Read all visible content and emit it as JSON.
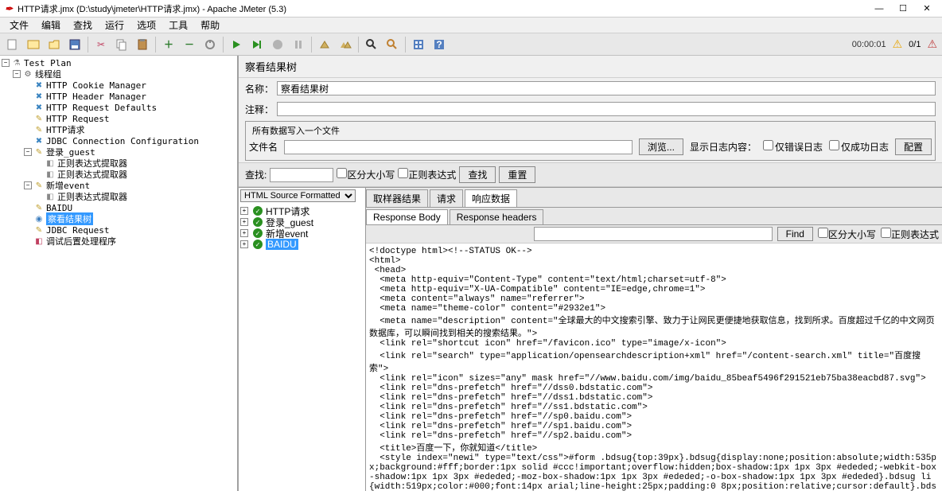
{
  "window": {
    "title": "HTTP请求.jmx (D:\\study\\jmeter\\HTTP请求.jmx) - Apache JMeter (5.3)"
  },
  "menu": {
    "file": "文件",
    "edit": "编辑",
    "search": "查找",
    "run": "运行",
    "options": "选项",
    "tools": "工具",
    "help": "帮助"
  },
  "status": {
    "timer": "00:00:01",
    "counter": "0/1"
  },
  "tree": {
    "root": "Test Plan",
    "threadgroup": "线程组",
    "items": [
      "HTTP Cookie Manager",
      "HTTP Header Manager",
      "HTTP Request Defaults",
      "HTTP Request",
      "HTTP请求",
      "JDBC Connection Configuration"
    ],
    "login": "登录_guest",
    "login_children": [
      "正则表达式提取器",
      "正则表达式提取器"
    ],
    "newevent": "新增event",
    "newevent_children": [
      "正则表达式提取器"
    ],
    "baidu": "BAIDU",
    "viewresults": "察看结果树",
    "jdbcreq": "JDBC Request",
    "debug": "调试后置处理程序"
  },
  "panel": {
    "title": "察看结果树",
    "name_label": "名称：",
    "name_value": "察看结果树",
    "comment_label": "注释：",
    "comment_value": "",
    "file_fieldset": "所有数据写入一个文件",
    "filename_label": "文件名",
    "filename_value": "",
    "browse": "浏览...",
    "logcontent_label": "显示日志内容：",
    "cb_erroronly": "仅错误日志",
    "cb_successonly": "仅成功日志",
    "configure": "配置",
    "search_label": "查找:",
    "cb_casesens": "区分大小写",
    "cb_regex": "正则表达式",
    "btn_search": "查找",
    "btn_reset": "重置"
  },
  "results": {
    "format_select": "HTML Source Formatted",
    "items": [
      "HTTP请求",
      "登录_guest",
      "新增event",
      "BAIDU"
    ],
    "selected": "BAIDU",
    "tabs": [
      "取样器结果",
      "请求",
      "响应数据"
    ],
    "subtabs": [
      "Response Body",
      "Response headers"
    ],
    "find_btn": "Find",
    "find_cb1": "区分大小写",
    "find_cb2": "正则表达式"
  },
  "response_body": "<!doctype html><!--STATUS OK-->\n<html>\n <head>\n  <meta http-equiv=\"Content-Type\" content=\"text/html;charset=utf-8\">\n  <meta http-equiv=\"X-UA-Compatible\" content=\"IE=edge,chrome=1\">\n  <meta content=\"always\" name=\"referrer\">\n  <meta name=\"theme-color\" content=\"#2932e1\">\n  <meta name=\"description\" content=\"全球最大的中文搜索引擎、致力于让网民更便捷地获取信息，找到所求。百度超过千亿的中文网页数据库，可以瞬间找到相关的搜索结果。\">\n  <link rel=\"shortcut icon\" href=\"/favicon.ico\" type=\"image/x-icon\">\n  <link rel=\"search\" type=\"application/opensearchdescription+xml\" href=\"/content-search.xml\" title=\"百度搜索\">\n  <link rel=\"icon\" sizes=\"any\" mask href=\"//www.baidu.com/img/baidu_85beaf5496f291521eb75ba38eacbd87.svg\">\n  <link rel=\"dns-prefetch\" href=\"//dss0.bdstatic.com\">\n  <link rel=\"dns-prefetch\" href=\"//dss1.bdstatic.com\">\n  <link rel=\"dns-prefetch\" href=\"//ss1.bdstatic.com\">\n  <link rel=\"dns-prefetch\" href=\"//sp0.baidu.com\">\n  <link rel=\"dns-prefetch\" href=\"//sp1.baidu.com\">\n  <link rel=\"dns-prefetch\" href=\"//sp2.baidu.com\">\n  <title>百度一下，你就知道</title>\n  <style index=\"newi\" type=\"text/css\">#form .bdsug{top:39px}.bdsug{display:none;position:absolute;width:535px;background:#fff;border:1px solid #ccc!important;overflow:hidden;box-shadow:1px 1px 3px #ededed;-webkit-box-shadow:1px 1px 3px #ededed;-moz-box-shadow:1px 1px 3px #ededed;-o-box-shadow:1px 1px 3px #ededed}.bdsug li{width:519px;color:#000;font:14px arial;line-height:25px;padding:0 8px;position:relative;cursor:default}.bdsug li.bdsug-s{background:#f0f0f0}.bdsug-store span,.bdsug-store b{color:#7A77C8}.bdsug-store-del{font-size:12px;color:#666;text-decoration:underline;position:absolute;right:8px;top:0;cursor:pointer;display:none}.bdsug-s .bdsug-store-del{display:inline-block}.bdsug-ala{display:inline-block;border-bottom:1px solid #e6e6e6}.bdsug-ala h3{line-height:14px;background:url(//www.baidu.com/img/sug_bd.png?v=09816787.png) no-repeat left center;margin:6px 0 4px;font-size:12px;font-weight:400;color:#7B7B7B;padding-left:20px}.bdsug-ala p{font-size:14px;font-weight:700;padding-left:20px}#m .bdsug .bdsug-direct p{color:#00e;font-weight:700;line-height:34px;padding:0 8px;margin-top:0;cursor:pointer;white-space:nowrap;overflow:hidden}#m .bdsug .bdsug-direct p img{width:16px;height:16px;margin:7px 6px 9px 0;vertical-align:middle}#m .bdsug .bdsug-direct p span{margin-left:8px}#form .bdsug .bdsug-direct{width:auto;padding:0;border-bottom:1px solid #f1f1f1}#form .bdsug .bdsug-direct p i{font-size:12px;line-height:100%;font-style:normal;font-weight:400;color:#fff;background-color:#2b99ff;display:inline;text-align:center;padding:1px 5px;*padding:2px 5px 0;margin-left:8px;overflow:hidden}.bdsug .bdsug-pcDirect{color:#000;font-size:14px;line-height:30px;height:30px;background-color:#f8f8f8}.bdsug .bdsug-pc-direct-tip{position:absolute;right:15px;top:8px;width:55px;height:15px;display:block;background:url(https://ss1.bdstatic.com/5eN1bjq8AAUYm2zgoY3K/r/www/cache/static/protocol/https/global/img/pc_direct_42d6311.png) no-repeat 0 0}.bdsug li.bdsug-pcDirect-s{background-color:#f0f0f0}.bdsug .bdsug-pcDirect-is{color:#000;font-size:14px;"
}
